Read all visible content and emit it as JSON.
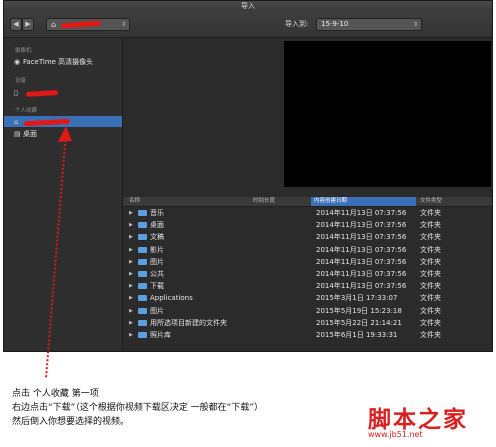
{
  "window": {
    "title": "导入"
  },
  "toolbar": {
    "back": "◀",
    "forward": "▶",
    "source_home_icon": "home-icon",
    "import_to_label": "导入到:",
    "import_to_value": "15-9-10",
    "chevron": "⌃"
  },
  "sidebar": {
    "section_camera": "摄像机",
    "camera_item": "FaceTime 高清摄像头",
    "section_devices": "设备",
    "section_favorites": "个人收藏",
    "desktop_item": "桌面"
  },
  "list": {
    "columns": {
      "name": "名称",
      "duration": "时间长度",
      "created": "内容创建日期",
      "kind": "文件类型"
    },
    "rows": [
      {
        "name": "音乐",
        "date": "2014年11月13日 07:37:56",
        "kind": "文件夹"
      },
      {
        "name": "桌面",
        "date": "2014年11月13日 07:37:56",
        "kind": "文件夹"
      },
      {
        "name": "文稿",
        "date": "2014年11月13日 07:37:56",
        "kind": "文件夹"
      },
      {
        "name": "影片",
        "date": "2014年11月13日 07:37:56",
        "kind": "文件夹"
      },
      {
        "name": "图片",
        "date": "2014年11月13日 07:37:56",
        "kind": "文件夹"
      },
      {
        "name": "公共",
        "date": "2014年11月13日 07:37:56",
        "kind": "文件夹"
      },
      {
        "name": "下载",
        "date": "2014年11月13日 07:37:56",
        "kind": "文件夹"
      },
      {
        "name": "Applications",
        "date": "2015年3月1日 17:33:07",
        "kind": "文件夹"
      },
      {
        "name": "图片",
        "date": "2015年5月19日 15:23:18",
        "kind": "文件夹"
      },
      {
        "name": "用所选项目新建的文件夹",
        "date": "2015年5月22日 21:14:21",
        "kind": "文件夹"
      },
      {
        "name": "照片库",
        "date": "2015年6月1日 19:33:31",
        "kind": "文件夹"
      }
    ]
  },
  "caption": {
    "line1": "点击 个人收藏 第一项",
    "line2": "右边点击“下载”（这个根据你视频下载区决定 一般都在“下载”）",
    "line3": "然后倒入你想要选择的视频。"
  },
  "watermark": {
    "text": "脚本之家",
    "url": "www.jb51.net"
  },
  "colors": {
    "accent": "#3a70b8",
    "annotation": "#e01818",
    "folder": "#5aa0e0"
  }
}
